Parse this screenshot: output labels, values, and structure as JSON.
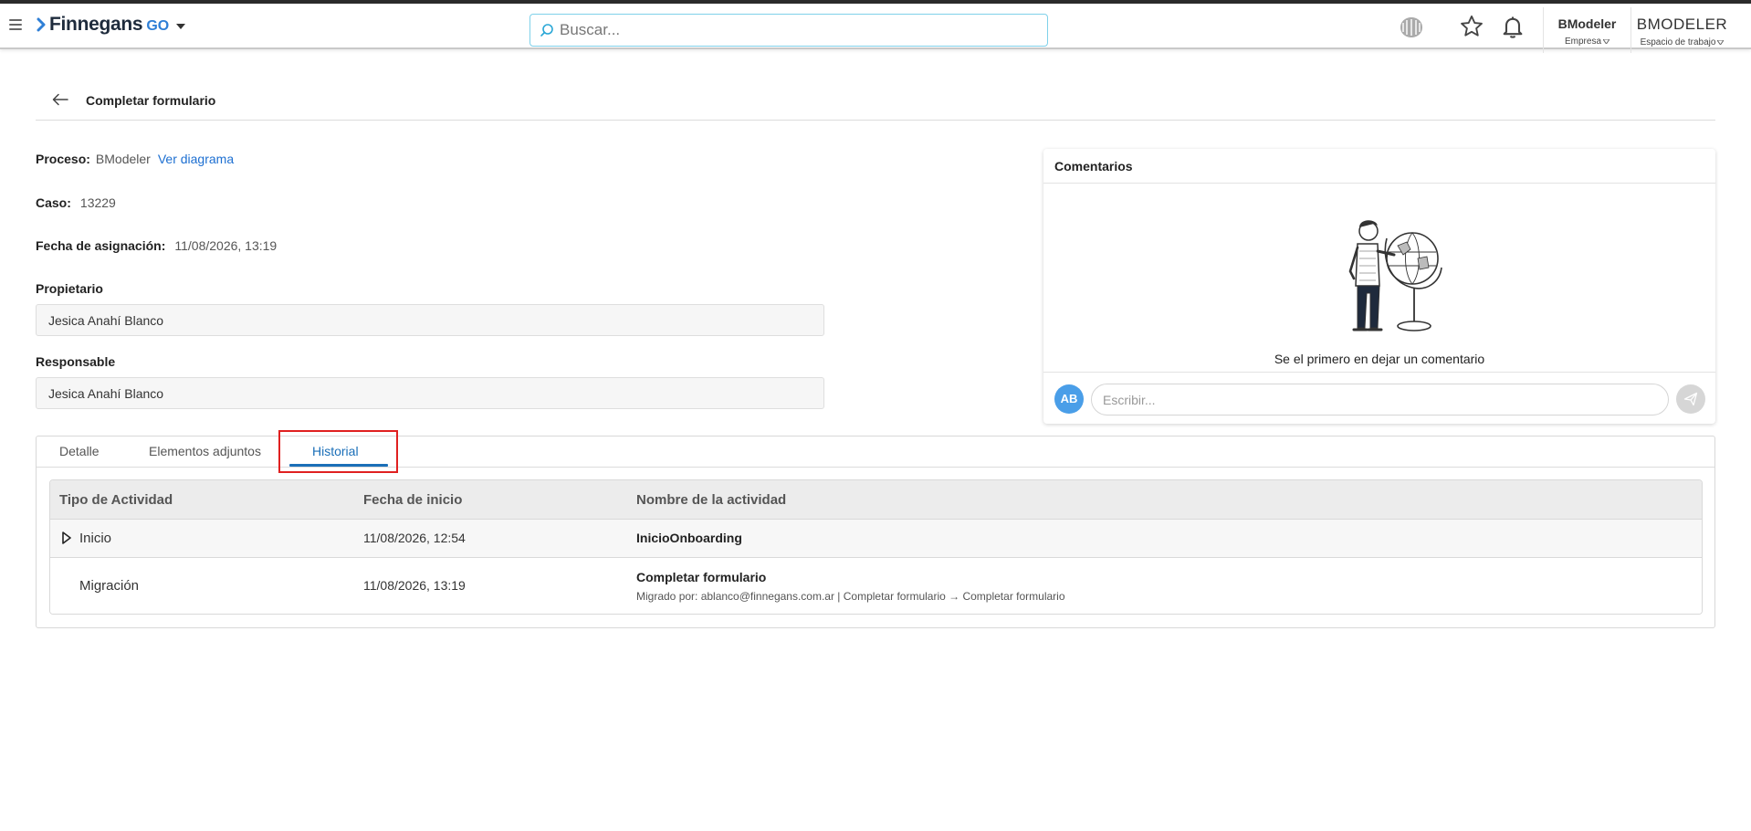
{
  "topbar": {
    "logo_text": "Finnegans",
    "logo_suffix": "GO",
    "search_placeholder": "Buscar...",
    "company_name": "BModeler",
    "company_label": "Empresa",
    "workspace_name": "BMODELER",
    "workspace_label": "Espacio de trabajo",
    "icons": [
      "menu-icon",
      "apps-icon",
      "star-icon",
      "bell-icon"
    ]
  },
  "page": {
    "title": "Completar formulario"
  },
  "details": {
    "proceso_label": "Proceso:",
    "proceso_value": "BModeler",
    "ver_diagrama": "Ver diagrama",
    "caso_label": "Caso:",
    "caso_value": "13229",
    "fecha_label": "Fecha de asignación:",
    "fecha_value": "11/08/2026, 13:19",
    "propietario_label": "Propietario",
    "propietario_value": "Jesica Anahí Blanco",
    "responsable_label": "Responsable",
    "responsable_value": "Jesica Anahí Blanco"
  },
  "comments": {
    "title": "Comentarios",
    "empty_text": "Se el primero en dejar un comentario",
    "avatar_initials": "AB",
    "input_placeholder": "Escribir..."
  },
  "tabs": [
    {
      "label": "Detalle",
      "active": false
    },
    {
      "label": "Elementos adjuntos",
      "active": false
    },
    {
      "label": "Historial",
      "active": true
    }
  ],
  "history": {
    "columns": [
      "Tipo de Actividad",
      "Fecha de inicio",
      "Nombre de la actividad"
    ],
    "rows": [
      {
        "tipo": "Inicio",
        "fecha": "11/08/2026, 12:54",
        "nombre": "InicioOnboarding",
        "detalle": ""
      },
      {
        "tipo": "Migración",
        "fecha": "11/08/2026, 13:19",
        "nombre": "Completar formulario",
        "detalle": "Migrado por: ablanco@finnegans.com.ar | Completar formulario → Completar formulario"
      }
    ]
  },
  "colors": {
    "accent": "#1b6fb8",
    "link": "#1d6fd1",
    "highlight": "#e02020",
    "avatar": "#4a9ee8"
  }
}
